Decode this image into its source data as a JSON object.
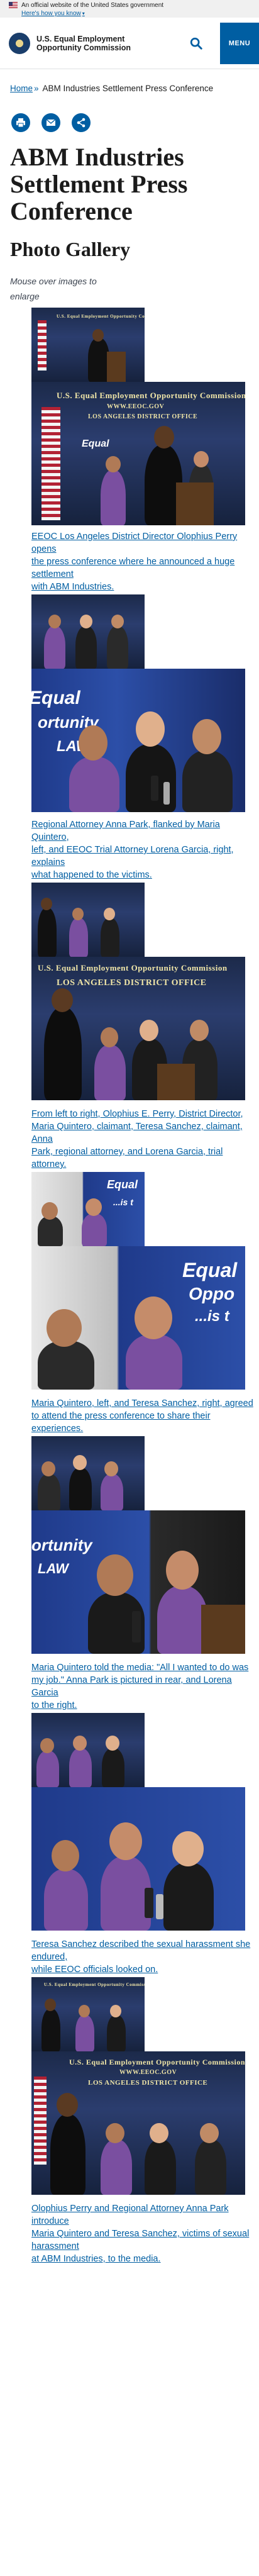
{
  "gov_banner": {
    "official_text": "An official website of the United States government",
    "how_know": "Here's how you know"
  },
  "header": {
    "agency_line1": "U.S. Equal Employment",
    "agency_line2": "Opportunity Commission",
    "menu_label": "MENU"
  },
  "breadcrumb": {
    "home": "Home",
    "separator": "»",
    "current": "ABM Industries Settlement Press Conference"
  },
  "page": {
    "title": "ABM Industries Settlement Press Conference",
    "section_title": "Photo Gallery",
    "hint": "Mouse over images to enlarge"
  },
  "gallery": {
    "banner_text_1": "U.S. Equal Employment Opportunity Commission",
    "banner_text_2": "WWW.EEOC.GOV",
    "banner_text_3": "LOS ANGELES DISTRICT OFFICE",
    "equal_word": "Equal",
    "opportunity_word": "Oppo",
    "is_word": "...is t",
    "unity_word": "ortunity",
    "law_word": "LAW",
    "items": [
      {
        "caption_lines": [
          "EEOC Los Angeles District Director Olophius Perry opens",
          "the press conference where he announced a huge settlement",
          "with ABM Industries."
        ]
      },
      {
        "caption_lines": [
          "Regional Attorney Anna Park, flanked by Maria Quintero,",
          "left, and EEOC Trial Attorney Lorena Garcia, right, explains",
          "what happened to the victims."
        ]
      },
      {
        "caption_lines": [
          "From left to right, Olophius E. Perry, District Director,",
          "Maria Quintero, claimant, Teresa Sanchez, claimant, Anna",
          "Park, regional attorney, and Lorena Garcia, trial attorney."
        ]
      },
      {
        "caption_lines": [
          "Maria Quintero, left, and Teresa Sanchez, right, agreed",
          "to attend the press conference to share their experiences."
        ]
      },
      {
        "caption_lines": [
          "Maria Quintero told the media: \"All I wanted to do was",
          "my job.\" Anna Park is pictured in rear, and Lorena Garcia",
          "to the right."
        ]
      },
      {
        "caption_lines": [
          "Teresa Sanchez described the sexual harassment she endured,",
          "while EEOC officials looked on."
        ]
      },
      {
        "caption_lines": [
          "Olophius Perry and Regional Attorney Anna Park introduce",
          "Maria Quintero and Teresa Sanchez, victims of sexual harassment",
          "at ABM Industries, to the media."
        ]
      }
    ]
  },
  "colors": {
    "link": "#005ea2",
    "menu_bg": "#005ea2",
    "banner_bg": "#f0f0f0"
  }
}
